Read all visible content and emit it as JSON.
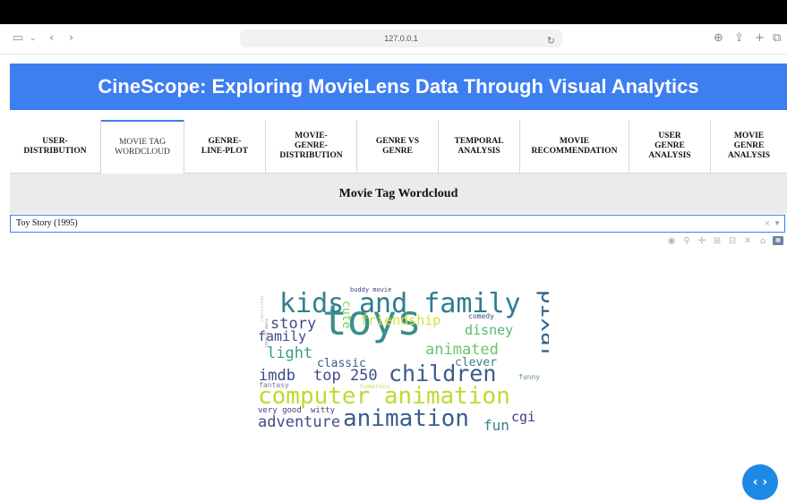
{
  "browser": {
    "url": "127.0.0.1",
    "icons": {
      "sidebar": "sidebar-icon",
      "back": "chevron-left-icon",
      "forward": "chevron-right-icon",
      "reload": "reload-icon",
      "download": "download-icon",
      "share": "share-icon",
      "new_tab": "plus-icon",
      "tabs": "tabs-icon"
    }
  },
  "app": {
    "title": "CineScope: Exploring MovieLens Data Through Visual Analytics",
    "accent": "#3d7ef0"
  },
  "tabs": [
    {
      "label": "USER-\nDISTRIBUTION"
    },
    {
      "label": "MOVIE TAG\nWORDCLOUD"
    },
    {
      "label": "GENRE-\nLINE-PLOT"
    },
    {
      "label": "MOVIE-\nGENRE-\nDISTRIBUTION"
    },
    {
      "label": "GENRE VS\nGENRE"
    },
    {
      "label": "TEMPORAL\nANALYSIS"
    },
    {
      "label": "MOVIE\nRECOMMENDATION"
    },
    {
      "label": "USER\nGENRE\nANALYSIS"
    },
    {
      "label": "MOVIE\nGENRE\nANALYSIS"
    }
  ],
  "section": {
    "title": "Movie Tag Wordcloud"
  },
  "movie_select": {
    "value": "Toy Story (1995)",
    "clear": "×",
    "arrow": "▼"
  },
  "modebar": {
    "icons": [
      "camera-icon",
      "zoom-icon",
      "pan-icon",
      "zoom-in-icon",
      "zoom-out-icon",
      "autoscale-icon",
      "reset-axes-icon",
      "plotly-logo-icon"
    ]
  },
  "wordcloud": {
    "words": [
      {
        "text": "toys",
        "color": "#3b8d8d"
      },
      {
        "text": "kids",
        "color": "#33808e"
      },
      {
        "text": "and family",
        "color": "#2d7d8e"
      },
      {
        "text": "pixar",
        "color": "#30658d"
      },
      {
        "text": "computer animation",
        "color": "#b9dd2d"
      },
      {
        "text": "animation",
        "color": "#3b5d8c"
      },
      {
        "text": "children",
        "color": "#3a5a8b"
      },
      {
        "text": "friendship",
        "color": "#d6e23a"
      },
      {
        "text": "animated",
        "color": "#66c66a"
      },
      {
        "text": "story",
        "color": "#3e4a89"
      },
      {
        "text": "family",
        "color": "#3e4a89"
      },
      {
        "text": "light",
        "color": "#3c9a8a"
      },
      {
        "text": "imdb",
        "color": "#3c4a88"
      },
      {
        "text": "top 250",
        "color": "#3c4a88"
      },
      {
        "text": "cute",
        "color": "#7ad151"
      },
      {
        "text": "disney",
        "color": "#5ab56b"
      },
      {
        "text": "clever",
        "color": "#3d7e8e"
      },
      {
        "text": "classic",
        "color": "#3c5a8b"
      },
      {
        "text": "adventure",
        "color": "#3b4f88"
      },
      {
        "text": "fun",
        "color": "#3d7f8d"
      },
      {
        "text": "cgi",
        "color": "#3c3f82"
      },
      {
        "text": "buddy movie",
        "color": "#3b4486"
      },
      {
        "text": "comedy",
        "color": "#3b4a88"
      },
      {
        "text": "fantasy",
        "color": "#7c7c9c"
      },
      {
        "text": "humorous",
        "color": "#c8df6a"
      },
      {
        "text": "funny",
        "color": "#5e8f9e"
      },
      {
        "text": "very good",
        "color": "#3b3f84"
      },
      {
        "text": "witty",
        "color": "#3b3f84"
      },
      {
        "text": "time travel",
        "color": "#9c8cb8"
      },
      {
        "text": "tearjerker",
        "color": "#c7cfa0"
      }
    ]
  },
  "fab": {
    "label": "‹ ›"
  }
}
